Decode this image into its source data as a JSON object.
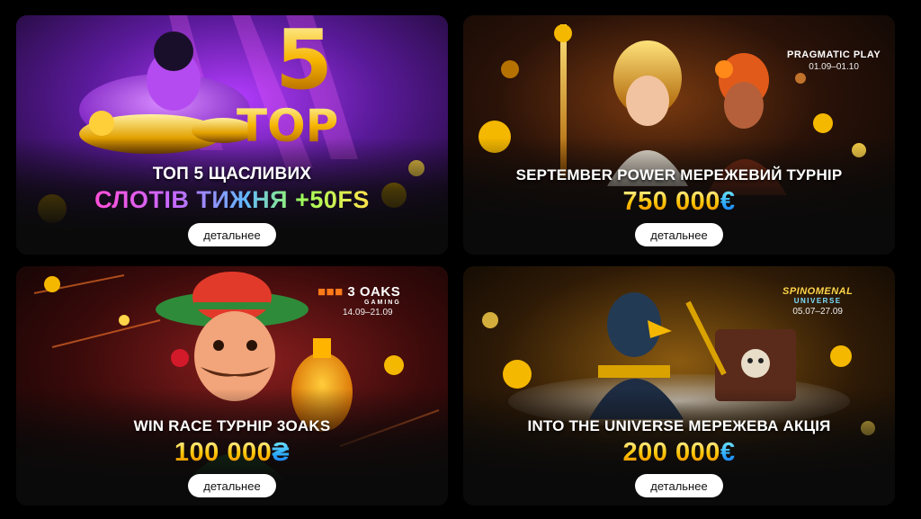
{
  "cards": [
    {
      "title": "ТОП 5 ЩАСЛИВИХ",
      "highlight": "СЛОТІВ ТИЖНЯ +50FS",
      "badge_number": "5",
      "badge_word": "TOP",
      "button": "детальнее"
    },
    {
      "title": "SEPTEMBER POWER МЕРЕЖЕВИЙ ТУРНІР",
      "amount": "750 000",
      "currency": "€",
      "provider": "PRAGMATIC PLAY",
      "dates": "01.09–01.10",
      "button": "детальнее"
    },
    {
      "title": "WIN RACE ТУРНІР 3OAKS",
      "amount": "100 000",
      "currency": "₴",
      "provider": "3 OAKS",
      "provider_sub": "GAMING",
      "dates": "14.09–21.09",
      "button": "детальнее"
    },
    {
      "title": "INTO THE UNIVERSE МЕРЕЖЕВА АКЦІЯ",
      "amount": "200 000",
      "currency": "€",
      "provider": "SPINOMENAL",
      "provider_sub": "UNIVERSE",
      "dates": "05.07–27.09",
      "button": "детальнее"
    }
  ],
  "colors": {
    "background": "#000000",
    "card": "#0a0a0a",
    "button_bg": "#ffffff",
    "button_text": "#111111",
    "gold": "#ffc400",
    "currency_blue": "#2aa7ff"
  }
}
